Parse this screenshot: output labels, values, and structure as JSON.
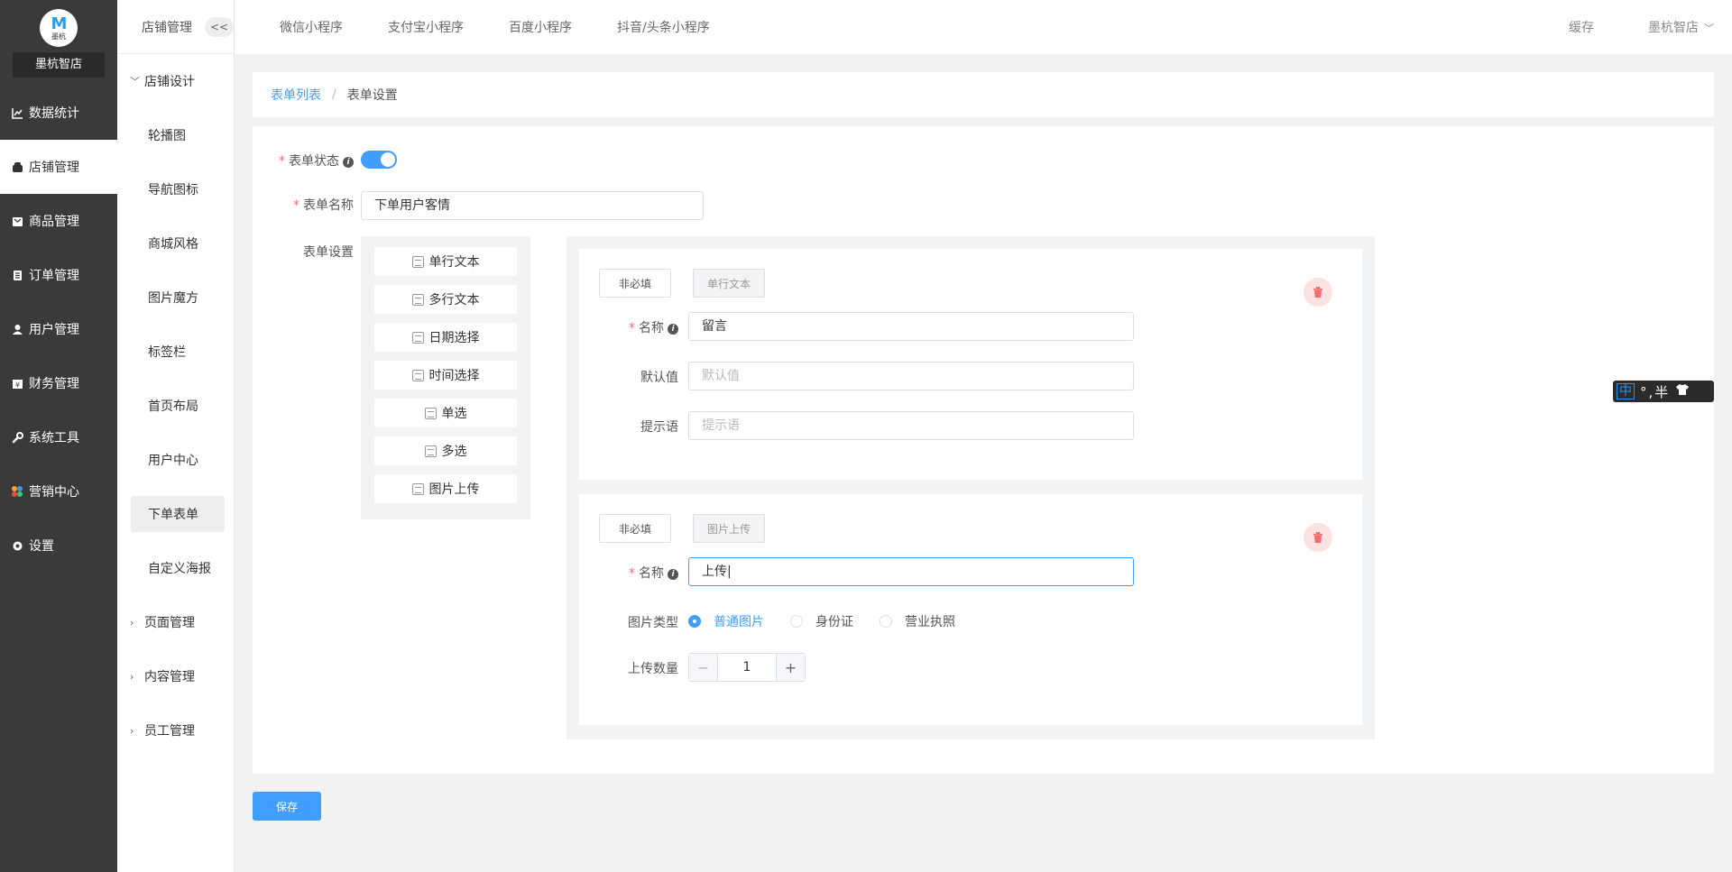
{
  "brand": {
    "logo_text": "墨杭",
    "shop_name": "墨杭智店"
  },
  "nav": [
    {
      "label": "数据统计",
      "icon": "chart-icon"
    },
    {
      "label": "店铺管理",
      "icon": "shop-icon",
      "active": true
    },
    {
      "label": "商品管理",
      "icon": "goods-icon"
    },
    {
      "label": "订单管理",
      "icon": "order-icon"
    },
    {
      "label": "用户管理",
      "icon": "user-icon"
    },
    {
      "label": "财务管理",
      "icon": "finance-icon"
    },
    {
      "label": "系统工具",
      "icon": "wrench-icon"
    },
    {
      "label": "营销中心",
      "icon": "marketing-icon"
    },
    {
      "label": "设置",
      "icon": "gear-icon"
    }
  ],
  "subnav": {
    "title": "店铺管理",
    "collapse": "<<",
    "group_design": "店铺设计",
    "items": [
      "轮播图",
      "导航图标",
      "商城风格",
      "图片魔方",
      "标签栏",
      "首页布局",
      "用户中心",
      "下单表单",
      "自定义海报"
    ],
    "groups_after": [
      "页面管理",
      "内容管理",
      "员工管理"
    ]
  },
  "topbar": {
    "tabs": [
      "微信小程序",
      "支付宝小程序",
      "百度小程序",
      "抖音/头条小程序"
    ],
    "cache": "缓存",
    "user": "墨杭智店"
  },
  "breadcrumb": {
    "link": "表单列表",
    "sep": "/",
    "current": "表单设置"
  },
  "form": {
    "status_label": "表单状态",
    "status_on": true,
    "name_label": "表单名称",
    "name_value": "下单用户客情",
    "settings_label": "表单设置",
    "palette": [
      "单行文本",
      "多行文本",
      "日期选择",
      "时间选择",
      "单选",
      "多选",
      "图片上传"
    ],
    "field1": {
      "required_btn": "非必填",
      "type_btn": "单行文本",
      "name_label": "名称",
      "name_value": "留言",
      "default_label": "默认值",
      "default_placeholder": "默认值",
      "hint_label": "提示语",
      "hint_placeholder": "提示语"
    },
    "field2": {
      "required_btn": "非必填",
      "type_btn": "图片上传",
      "name_label": "名称",
      "name_value": "上传|",
      "img_type_label": "图片类型",
      "img_types": [
        "普通图片",
        "身份证",
        "营业执照"
      ],
      "selected_type": "普通图片",
      "count_label": "上传数量",
      "count_value": "1",
      "minus": "−",
      "plus": "+"
    },
    "save": "保存"
  },
  "ime": {
    "mode": "中",
    "rest": "°,半"
  },
  "colors": {
    "primary": "#409eff",
    "sidebar": "#3a3a3a",
    "danger": "#f56c6c"
  }
}
